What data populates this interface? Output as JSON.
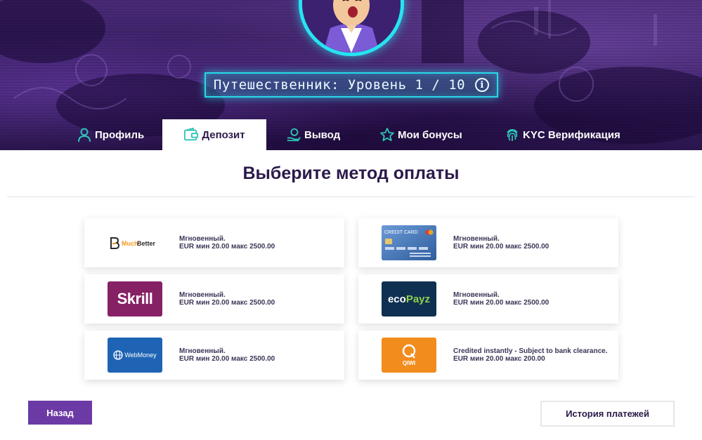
{
  "profile": {
    "level_text": "Путешественник: Уровень 1 / 10",
    "info_icon": "info-icon",
    "info_glyph": "i"
  },
  "tabs": [
    {
      "label": "Профиль",
      "icon": "user-icon",
      "active": false
    },
    {
      "label": "Депозит",
      "icon": "wallet-icon",
      "active": true
    },
    {
      "label": "Вывод",
      "icon": "hand-coin-icon",
      "active": false
    },
    {
      "label": "Мои бонусы",
      "icon": "star-icon",
      "active": false
    },
    {
      "label": "KYC Верификация",
      "icon": "fingerprint-icon",
      "active": false
    }
  ],
  "page_title": "Выберите метод оплаты",
  "methods": [
    {
      "name": "MuchBetter",
      "logo_text": "MuchBetter",
      "logo_prefix": "Much",
      "logo_suffix": "Better",
      "line1": "Мгновенный.",
      "line2": "EUR мин 20.00 макс 2500.00"
    },
    {
      "name": "Credit Card",
      "logo_text": "CREDIT CARD",
      "line1": "Мгновенный.",
      "line2": "EUR мин 20.00 макс 2500.00"
    },
    {
      "name": "Skrill",
      "logo_text": "Skrill",
      "line1": "Мгновенный.",
      "line2": "EUR мин 20.00 макс 2500.00"
    },
    {
      "name": "ecoPayz",
      "logo_text": "ecoPayz",
      "logo_prefix": "eco",
      "logo_suffix": "Payz",
      "line1": "Мгновенный.",
      "line2": "EUR мин 20.00 макс 2500.00"
    },
    {
      "name": "WebMoney",
      "logo_text": "WebMoney",
      "line1": "Мгновенный.",
      "line2": "EUR мин 20.00 макс 2500.00"
    },
    {
      "name": "QIWI",
      "logo_text": "QIWI",
      "line1": "Credited instantly - Subject to bank clearance.",
      "line2": "EUR мин 20.00 макс 200.00"
    }
  ],
  "buttons": {
    "back": "Назад",
    "history": "История платежей"
  },
  "colors": {
    "accent_purple": "#6c3aa5",
    "neon_cyan": "#29d9e8",
    "hero_purple": "#3a1f66",
    "tab_icon_teal": "#2ec4b6",
    "skrill": "#862165",
    "ecopayz": "#0f3050",
    "webmoney": "#1f64b4",
    "qiwi": "#f28c1c",
    "creditcard": "#3f6fb0"
  }
}
